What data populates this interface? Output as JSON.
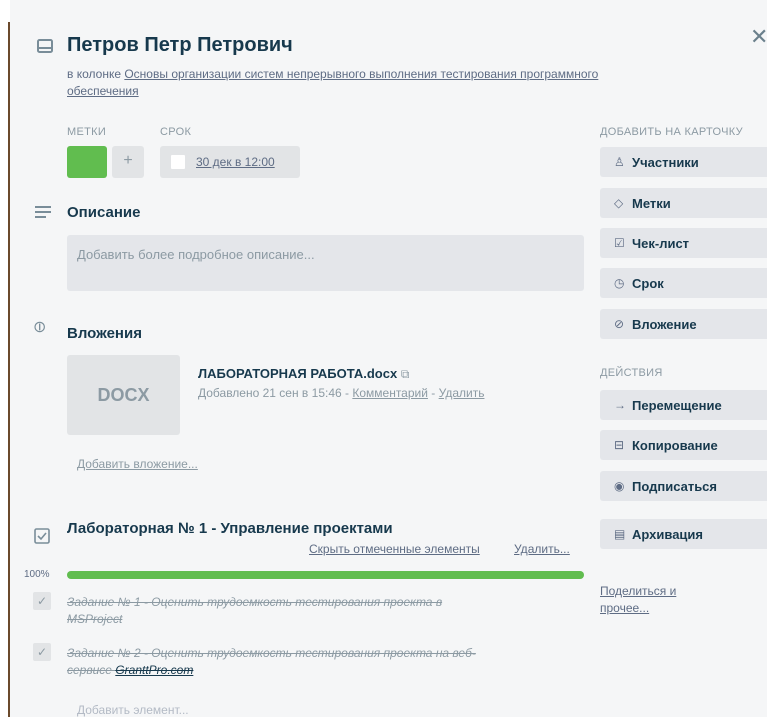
{
  "card": {
    "title": "Петров Петр Петрович",
    "list_prefix": "в колонке",
    "list_name_line1": "Основы организации систем непрерывного выполнения тестирования программного",
    "list_name_line2": "обеспечения"
  },
  "labels_heading": "МЕТКИ",
  "due_heading": "СРОК",
  "add_label_symbol": "+",
  "due_date": "30 дек в 12:00",
  "label_color": "#61bd4f",
  "description": {
    "heading": "Описание",
    "placeholder": "Добавить более подробное описание..."
  },
  "attachments": {
    "heading": "Вложения",
    "thumb_label": "DOCX",
    "file_name": "ЛАБОРАТОРНАЯ РАБОТА.docx",
    "added_text": "Добавлено 21 сен в 15:46 -",
    "comment_link": "Комментарий",
    "separator": "-",
    "delete_link": "Удалить",
    "add_link": "Добавить вложение..."
  },
  "checklist": {
    "title": "Лабораторная № 1 - Управление проектами",
    "hide_checked": "Скрыть отмеченные элементы",
    "delete": "Удалить...",
    "percent_label": "100%",
    "progress_fraction": 1.0,
    "items": [
      {
        "line1": "Задание № 1 - Оценить трудоемкость тестирования проекта в",
        "line2": "MSProject",
        "checked": true
      },
      {
        "line1": "Задание № 2 - Оценить трудоемкость тестирования проекта на веб-",
        "line2_prefix": "сервисе",
        "line2_link": "GranttPro.com",
        "checked": true
      }
    ],
    "add_item": "Добавить элемент..."
  },
  "sidebar": {
    "add_heading": "ДОБАВИТЬ НА КАРТОЧКУ",
    "add_buttons": [
      {
        "label": "Участники",
        "icon": "person-icon"
      },
      {
        "label": "Метки",
        "icon": "tag-icon"
      },
      {
        "label": "Чек-лист",
        "icon": "checkbox-icon"
      },
      {
        "label": "Срок",
        "icon": "clock-icon"
      },
      {
        "label": "Вложение",
        "icon": "paperclip-icon"
      }
    ],
    "actions_heading": "ДЕЙСТВИЯ",
    "action_buttons": [
      {
        "label": "Перемещение",
        "icon": "arrow-right-icon"
      },
      {
        "label": "Копирование",
        "icon": "card-icon"
      },
      {
        "label": "Подписаться",
        "icon": "eye-icon"
      },
      {
        "label": "Архивация",
        "icon": "archive-icon"
      }
    ],
    "share_line1": "Поделиться и",
    "share_line2": "прочее..."
  }
}
